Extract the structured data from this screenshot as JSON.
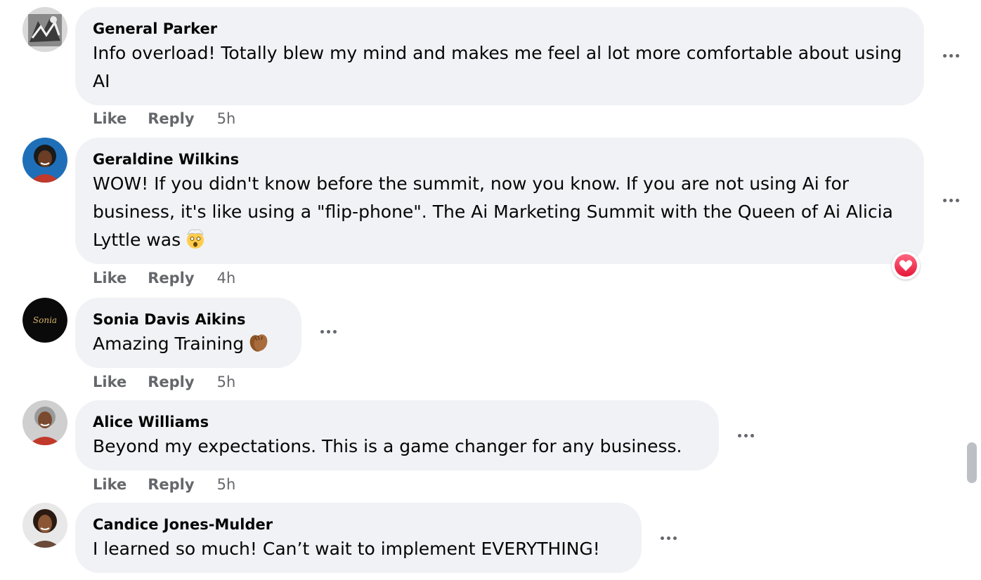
{
  "colors": {
    "bubble": "#f0f2f5",
    "meta_text": "#65676b",
    "love": "#e61739"
  },
  "comments": [
    {
      "author": "General Parker",
      "text": "Info overload! Totally blew my mind and makes me feel al lot more comfortable about using AI",
      "like_label": "Like",
      "reply_label": "Reply",
      "time": "5h",
      "avatar_icon": "profile-photo"
    },
    {
      "author": "Geraldine Wilkins",
      "text": "WOW! If you didn't know before the summit, now you know. If you are not using Ai for business, it's like using a \"flip-phone\". The Ai Marketing Summit with the Queen of Ai Alicia Lyttle was",
      "emoji": "exploding-head-emoji",
      "reaction": "love-heart-icon",
      "like_label": "Like",
      "reply_label": "Reply",
      "time": "4h",
      "avatar_icon": "profile-photo"
    },
    {
      "author": "Sonia Davis Aikins",
      "text": "Amazing Training",
      "emoji": "clapping-hands-emoji",
      "avatar_text": "Sonia",
      "like_label": "Like",
      "reply_label": "Reply",
      "time": "5h",
      "avatar_icon": "profile-logo"
    },
    {
      "author": "Alice Williams",
      "text": "Beyond my expectations. This is a game changer for any business.",
      "like_label": "Like",
      "reply_label": "Reply",
      "time": "5h",
      "avatar_icon": "profile-photo"
    },
    {
      "author": "Candice Jones-Mulder",
      "text": "I learned so much! Can’t wait to implement EVERYTHING!",
      "like_label": "Like",
      "reply_label": "Reply",
      "time": "",
      "avatar_icon": "profile-photo"
    }
  ]
}
